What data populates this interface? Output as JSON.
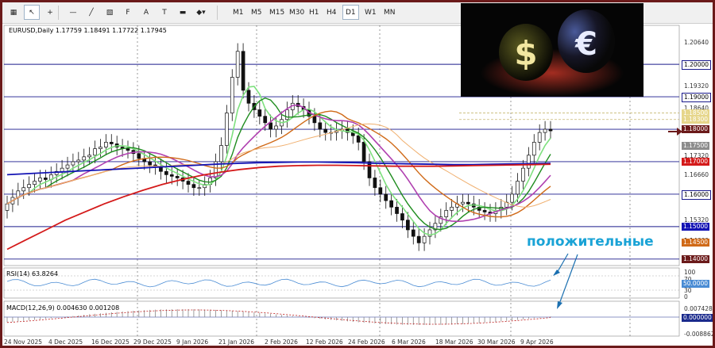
{
  "toolbar": {
    "icons": [
      {
        "name": "grid-icon",
        "glyph": "▦"
      },
      {
        "name": "cursor-icon",
        "glyph": "↖"
      },
      {
        "name": "crosshair-icon",
        "glyph": "+"
      },
      {
        "name": "horizontal-line-icon",
        "glyph": "—"
      },
      {
        "name": "trendline-icon",
        "glyph": "╱"
      },
      {
        "name": "channel-icon",
        "glyph": "▧"
      },
      {
        "name": "fibonacci-icon",
        "glyph": "F"
      },
      {
        "name": "text-icon",
        "glyph": "A"
      },
      {
        "name": "label-icon",
        "glyph": "T"
      },
      {
        "name": "rectangle-icon",
        "glyph": "▬"
      },
      {
        "name": "shapes-menu-icon",
        "glyph": "◆▾"
      }
    ],
    "timeframes": [
      "M1",
      "M5",
      "M15",
      "M30",
      "H1",
      "H4",
      "D1",
      "W1",
      "MN"
    ],
    "active_timeframe": "D1"
  },
  "chart": {
    "title": "EURUSD,Daily  1.17759 1.18491 1.17722 1.17945",
    "rsi_label": "RSI(14) 63.8264",
    "macd_label": "MACD(12,26,9) 0.004630 0.001208",
    "annotation": "положительные"
  },
  "colors": {
    "hline": "#1a1a8c",
    "ma_blue": "#1414b4",
    "ma_red": "#d41a1a",
    "ma_green": "#1e8c1e",
    "ma_lightgreen": "#7ee07e",
    "ma_purple": "#b040b0",
    "ma_orange": "#d06a18",
    "ma_lightorange": "#f0b070",
    "annotation": "#1aa3d6"
  },
  "price_axis": {
    "labels": [
      "1.20640",
      "1.19320",
      "1.18640",
      "1.17320",
      "1.16660",
      "1.15320",
      "1.14660",
      "100",
      "70",
      "30",
      "0",
      "0.007428",
      "-0.008862"
    ],
    "badges": [
      {
        "text": "1.20000",
        "price": 1.2,
        "bg": "#ffffff",
        "fg": "#000000"
      },
      {
        "text": "1.19000",
        "price": 1.19,
        "bg": "#ffffff",
        "fg": "#000000"
      },
      {
        "text": "1.18500",
        "price": 1.185,
        "bg": "#e6d68a",
        "fg": "#ffffff"
      },
      {
        "text": "1.18300",
        "price": 1.183,
        "bg": "#e6d68a",
        "fg": "#ffffff"
      },
      {
        "text": "1.18000",
        "price": 1.18,
        "bg": "#6b1a1a",
        "fg": "#ffffff"
      },
      {
        "text": "1.17500",
        "price": 1.175,
        "bg": "#8c8c8c",
        "fg": "#ffffff"
      },
      {
        "text": "1.17000",
        "price": 1.17,
        "bg": "#d41a1a",
        "fg": "#ffffff"
      },
      {
        "text": "1.16000",
        "price": 1.16,
        "bg": "#ffffff",
        "fg": "#000000"
      },
      {
        "text": "1.15000",
        "price": 1.15,
        "bg": "#1414b4",
        "fg": "#ffffff"
      },
      {
        "text": "1.14500",
        "price": 1.145,
        "bg": "#d06a18",
        "fg": "#ffffff"
      },
      {
        "text": "1.14000",
        "price": 1.14,
        "bg": "#6b1a1a",
        "fg": "#ffffff"
      },
      {
        "text": "50.0000",
        "price": 50,
        "bg": "#4a8cd4",
        "fg": "#ffffff",
        "pane": "rsi"
      },
      {
        "text": "0.000000",
        "price": 0,
        "bg": "#1a2a8c",
        "fg": "#ffffff",
        "pane": "macd"
      }
    ]
  },
  "time_axis": [
    "24 Nov 2025",
    "4 Dec 2025",
    "16 Dec 2025",
    "29 Dec 2025",
    "9 Jan 2026",
    "21 Jan 2026",
    "2 Feb 2026",
    "12 Feb 2026",
    "24 Feb 2026",
    "6 Mar 2026",
    "18 Mar 2026",
    "30 Mar 2026",
    "9 Apr 2026"
  ],
  "chart_data": {
    "type": "candlestick",
    "symbol": "EURUSD",
    "timeframe": "Daily",
    "ylim": [
      1.138,
      1.212
    ],
    "horizontal_levels": [
      1.2,
      1.19,
      1.18,
      1.17,
      1.16,
      1.15,
      1.14
    ],
    "close": [
      1.157,
      1.159,
      1.161,
      1.162,
      1.163,
      1.164,
      1.165,
      1.1645,
      1.166,
      1.167,
      1.168,
      1.169,
      1.17,
      1.1705,
      1.1715,
      1.172,
      1.174,
      1.1745,
      1.176,
      1.1755,
      1.1745,
      1.174,
      1.1735,
      1.1725,
      1.171,
      1.17,
      1.169,
      1.1685,
      1.167,
      1.166,
      1.1655,
      1.165,
      1.164,
      1.163,
      1.162,
      1.162,
      1.163,
      1.165,
      1.17,
      1.175,
      1.185,
      1.196,
      1.204,
      1.192,
      1.188,
      1.186,
      1.184,
      1.182,
      1.18,
      1.181,
      1.183,
      1.186,
      1.188,
      1.187,
      1.186,
      1.184,
      1.182,
      1.18,
      1.179,
      1.179,
      1.1795,
      1.18,
      1.179,
      1.178,
      1.176,
      1.17,
      1.165,
      1.162,
      1.16,
      1.158,
      1.156,
      1.154,
      1.152,
      1.149,
      1.147,
      1.145,
      1.147,
      1.149,
      1.151,
      1.153,
      1.155,
      1.156,
      1.157,
      1.1575,
      1.157,
      1.156,
      1.155,
      1.1545,
      1.154,
      1.155,
      1.156,
      1.1575,
      1.16,
      1.164,
      1.168,
      1.172,
      1.176,
      1.179,
      1.18,
      1.1795
    ],
    "ma_blue": [
      1.166,
      1.1663,
      1.1666,
      1.1669,
      1.1672,
      1.1675,
      1.1678,
      1.1681,
      1.1684,
      1.1687,
      1.169,
      1.1693,
      1.1695,
      1.1697,
      1.1698,
      1.1699,
      1.1699,
      1.1698,
      1.1697,
      1.1695,
      1.1694,
      1.1693,
      1.1692,
      1.1691,
      1.1691,
      1.1692,
      1.1693,
      1.1694,
      1.1695
    ],
    "ma_red": [
      1.143,
      1.146,
      1.149,
      1.152,
      1.1545,
      1.157,
      1.1592,
      1.1612,
      1.163,
      1.1645,
      1.1658,
      1.1668,
      1.1676,
      1.1682,
      1.1686,
      1.1688,
      1.1689,
      1.1689,
      1.1688,
      1.1687,
      1.1686,
      1.1686,
      1.1686,
      1.1687,
      1.1688,
      1.1689,
      1.169,
      1.1691,
      1.1692
    ]
  }
}
